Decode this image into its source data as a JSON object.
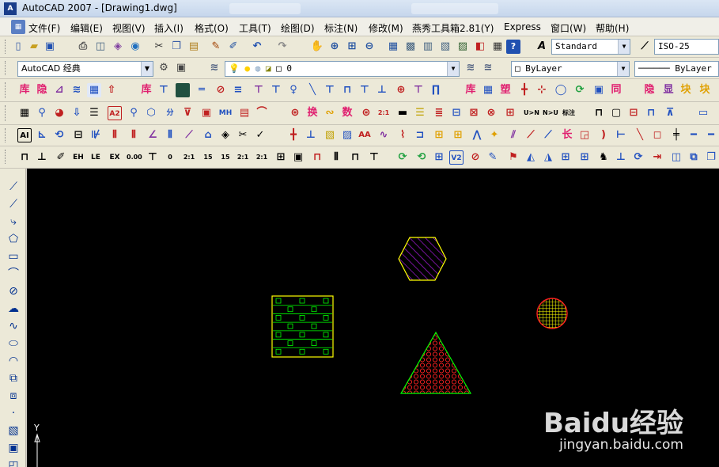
{
  "window": {
    "title": "AutoCAD 2007 - [Drawing1.dwg]",
    "app_icon": "autocad-app-icon"
  },
  "menu": {
    "items": [
      "文件(F)",
      "编辑(E)",
      "视图(V)",
      "插入(I)",
      "格式(O)",
      "工具(T)",
      "绘图(D)",
      "标注(N)",
      "修改(M)",
      "燕秀工具箱2.81(Y)",
      "Express",
      "窗口(W)",
      "帮助(H)"
    ]
  },
  "toolbar_std": {
    "text_style": "Standard",
    "dim_style": "ISO-25"
  },
  "toolbar_layers": {
    "workspace": "AutoCAD 经典",
    "layer": "0",
    "color": "ByLayer",
    "linetype": "ByLayer"
  },
  "toolbar_yanxiu_row1": [
    "库",
    "隐",
    "塑",
    "同",
    "库",
    "隐",
    "显",
    "块",
    "块"
  ],
  "toolbar_yanxiu_row2": [
    "换",
    "数",
    "U>N",
    "N>U",
    "标注"
  ],
  "toolbar_yanxiu_row3": [
    "长"
  ],
  "ucs": {
    "y_label": "Y"
  },
  "watermark": {
    "logo": "Baidu经验",
    "url": "jingyan.baidu.com"
  },
  "colors": {
    "canvas": "#000000",
    "hex_outline": "#ffff00",
    "hex_hatch": "#c020ff",
    "rect_outline": "#ffff00",
    "rect_hatch": "#00ff00",
    "circle_outline": "#ff2020",
    "circle_hatch": "#ffff00",
    "tri_outline": "#00ff00",
    "tri_hatch": "#ff2020"
  }
}
